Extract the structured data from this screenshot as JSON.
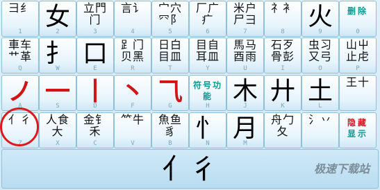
{
  "keys": {
    "row1": [
      {
        "small": "⺕纟",
        "big": "",
        "label": "1"
      },
      {
        "small": "",
        "big": "女",
        "label": "2"
      },
      {
        "small": "立門门",
        "big": "",
        "label": "3"
      },
      {
        "small": "言讠",
        "big": "",
        "label": "4"
      },
      {
        "small": "宀穴⺳阝",
        "big": "",
        "label": "5"
      },
      {
        "small": "厂广疒",
        "big": "",
        "label": "6"
      },
      {
        "small": "米户尸彐",
        "big": "",
        "label": "7"
      },
      {
        "small": "礻衤",
        "big": "",
        "label": "8"
      },
      {
        "small": "",
        "big": "火",
        "label": "9"
      },
      {
        "small": "",
        "big": "",
        "label": "0",
        "fn": "删除"
      }
    ],
    "row2": [
      {
        "small": "車车艹革",
        "big": "",
        "label": "Q"
      },
      {
        "small": "",
        "big": "扌",
        "label": "W"
      },
      {
        "small": "",
        "big": "口",
        "label": "E"
      },
      {
        "small": "⻊门贝黑",
        "big": "",
        "label": "R"
      },
      {
        "small": "日白目皿",
        "big": "",
        "label": "T"
      },
      {
        "small": "目自耳皿",
        "big": "",
        "label": "Y"
      },
      {
        "small": "馬马酉雨",
        "big": "",
        "label": "U"
      },
      {
        "small": "石歹骨彭",
        "big": "",
        "label": "I"
      },
      {
        "small": "虫习又弓",
        "big": "",
        "label": "O"
      },
      {
        "small": "山屮止虍",
        "big": "",
        "label": "P"
      }
    ],
    "row3": [
      {
        "small": "",
        "big": "ノ",
        "label": "A",
        "red": true
      },
      {
        "small": "",
        "big": "一",
        "label": "S",
        "red": true
      },
      {
        "small": "",
        "big": "丨",
        "label": "D",
        "red": true
      },
      {
        "small": "",
        "big": "丶",
        "label": "F",
        "red": true
      },
      {
        "small": "",
        "big": "⺄",
        "label": "G",
        "red": true
      },
      {
        "small": "",
        "big": "",
        "label": "H",
        "fn": "符号功能"
      },
      {
        "small": "",
        "big": "木",
        "label": "J"
      },
      {
        "small": "",
        "big": "廾",
        "label": "K"
      },
      {
        "small": "",
        "big": "土",
        "label": "L"
      },
      {
        "small": "王十",
        "big": "",
        "label": ""
      }
    ],
    "row4": [
      {
        "small": "亻彳",
        "big": "",
        "label": "Z"
      },
      {
        "small": "人食大",
        "big": "",
        "label": "X"
      },
      {
        "small": "金钅禾",
        "big": "",
        "label": "C"
      },
      {
        "small": "⺮牛",
        "big": "",
        "label": "V"
      },
      {
        "small": "魚鱼豸",
        "big": "",
        "label": "B"
      },
      {
        "small": "",
        "big": "忄",
        "label": "N"
      },
      {
        "small": "",
        "big": "月",
        "label": "M"
      },
      {
        "small": "舟勹夂",
        "big": "",
        "label": ""
      },
      {
        "small": "氵丷",
        "big": "",
        "label": ""
      },
      {
        "small": "",
        "big": "",
        "label": "",
        "fn": "隐藏显示"
      }
    ]
  },
  "display": {
    "text": "亻彳"
  },
  "watermark": "极速下载站"
}
